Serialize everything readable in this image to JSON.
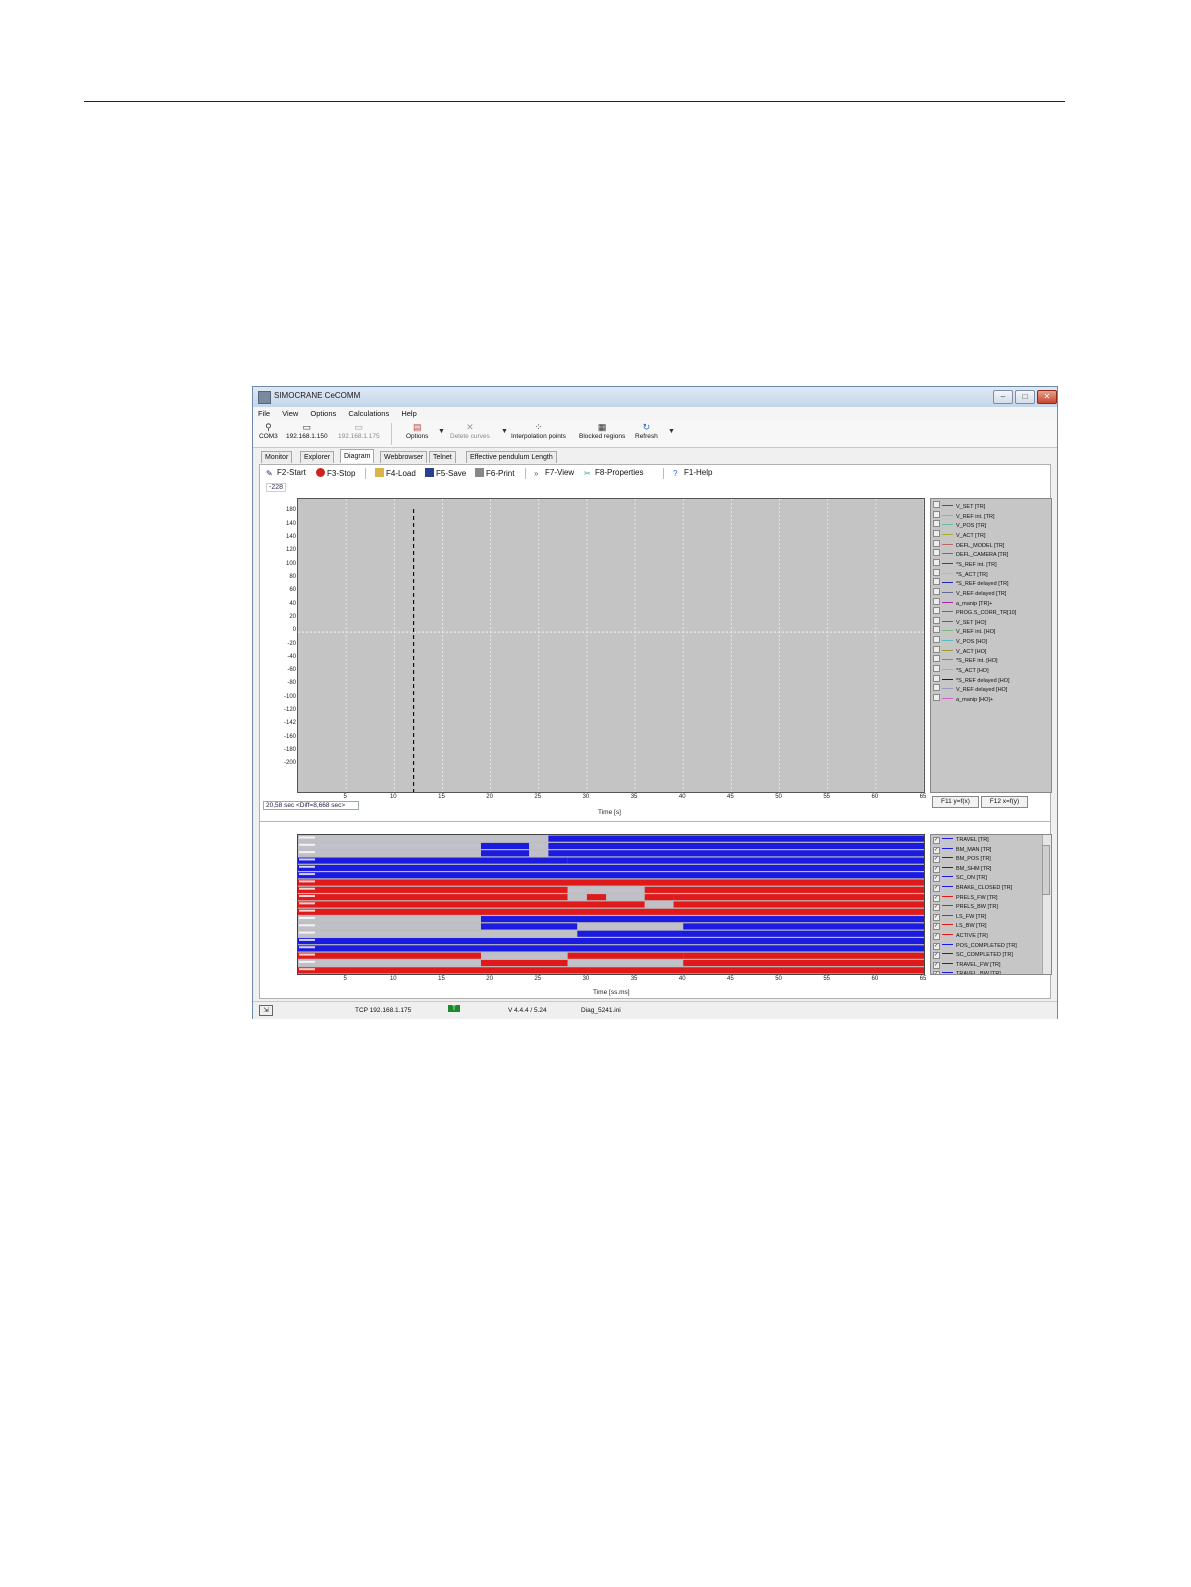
{
  "window": {
    "title": "SIMOCRANE CeCOMM",
    "controls": {
      "minimize": "–",
      "maximize": "□",
      "close": "✕"
    }
  },
  "menu": [
    "File",
    "View",
    "Options",
    "Calculations",
    "Help"
  ],
  "toolbar": {
    "com": "COM3",
    "ip_active": "192.168.1.150",
    "ip_inactive": "192.168.1.175",
    "options": "Options",
    "delete_curves": "Delete curves",
    "interpolation_points": "Interpolation points",
    "blocked_regions": "Blocked regions",
    "refresh": "Refresh"
  },
  "tabs": [
    "Monitor",
    "Explorer",
    "Diagram",
    "Webbrowser",
    "Telnet",
    "Effective pendulum Length"
  ],
  "commands": {
    "start": "F2-Start",
    "stop": "F3-Stop",
    "load": "F4-Load",
    "save": "F5-Save",
    "print": "F6-Print",
    "view": "F7-View",
    "properties": "F8-Properties",
    "help": "F1-Help"
  },
  "readouts": {
    "top_value": "-228",
    "cursor": "20,58 sec <Diff=8,668 sec>"
  },
  "chart_data": [
    {
      "type": "line",
      "title": "",
      "xlabel": "Time [s]",
      "ylabel": "",
      "xlim": [
        0,
        65
      ],
      "ylim": [
        -240,
        200
      ],
      "x_ticks": [
        5,
        10,
        15,
        20,
        25,
        30,
        35,
        40,
        45,
        50,
        55,
        60,
        65
      ],
      "x_tick_labels": [
        "5",
        "10",
        "15",
        "20",
        "25",
        "30",
        "35",
        "40",
        "45",
        "50",
        "55",
        "60",
        "65"
      ],
      "y_ticks": [
        180,
        160,
        140,
        120,
        100,
        80,
        60,
        40,
        20,
        0,
        -20,
        -40,
        -60,
        -80,
        -100,
        -120,
        -140,
        -160,
        -180,
        -200
      ],
      "y_tick_labels": [
        "180",
        "140",
        "140",
        "120",
        "100",
        "80",
        "60",
        "40",
        "20",
        "0",
        "-20",
        "-40",
        "-60",
        "-80",
        "-100",
        "-120",
        "-142",
        "-160",
        "-180",
        "-200"
      ],
      "cursor_x": 12,
      "grid": true,
      "legend_placement": "right",
      "series": [
        {
          "name": "V_SET [TR]",
          "color": "#cc2222",
          "checked": false
        },
        {
          "name": "V_REF int. [TR]",
          "color": "#88bb88",
          "checked": false
        },
        {
          "name": "V_POS [TR]",
          "color": "#66bbaa",
          "checked": false
        },
        {
          "name": "V_ACT [TR]",
          "color": "#aaaa33",
          "checked": false
        },
        {
          "name": "DEFL_MODEL [TR]",
          "color": "#bb6666",
          "checked": false
        },
        {
          "name": "DEFL_CAMERA [TR]",
          "color": "#6666bb",
          "checked": false
        },
        {
          "name": "*S_REF int. [TR]",
          "color": "#444444",
          "checked": false
        },
        {
          "name": "*S_ACT [TR]",
          "color": "#cccc22",
          "checked": false
        },
        {
          "name": "*S_REF delayed [TR]",
          "color": "#2222aa",
          "checked": false
        },
        {
          "name": "V_REF delayed [TR]",
          "color": "#666699",
          "checked": false
        },
        {
          "name": "a_manip [TR]+",
          "color": "#aa22aa",
          "checked": false
        },
        {
          "name": "PROG.S_CORR_TR[10]",
          "color": "#bb33bb",
          "checked": false
        },
        {
          "name": "V_SET [HO]",
          "color": "#cc3333",
          "checked": false
        },
        {
          "name": "V_REF int. [HO]",
          "color": "#77bb77",
          "checked": false
        },
        {
          "name": "V_POS [HO]",
          "color": "#55bbbb",
          "checked": false
        },
        {
          "name": "V_ACT [HO]",
          "color": "#999933",
          "checked": false
        },
        {
          "name": "*S_REF int. [HO]",
          "color": "#888888",
          "checked": false
        },
        {
          "name": "*S_ACT [HO]",
          "color": "#bbbb22",
          "checked": false
        },
        {
          "name": "*S_REF delayed [HO]",
          "color": "#1111aa",
          "checked": false
        },
        {
          "name": "V_REF delayed [HO]",
          "color": "#9999bb",
          "checked": false
        },
        {
          "name": "a_manip [HO]+",
          "color": "#cc66cc",
          "checked": false
        }
      ]
    },
    {
      "type": "heatmap",
      "title": "",
      "xlabel": "Time [ss.ms]",
      "ylabel": "",
      "xlim": [
        0,
        65
      ],
      "x_ticks": [
        5,
        10,
        15,
        20,
        25,
        30,
        35,
        40,
        45,
        50,
        55,
        60,
        65
      ],
      "x_tick_labels": [
        "5",
        "10",
        "15",
        "20",
        "25",
        "30",
        "35",
        "40",
        "45",
        "50",
        "55",
        "60",
        "65"
      ],
      "legend_placement": "right",
      "states_note": "each track: 0 = off (grey), 1 = on (track colour)",
      "tracks": [
        {
          "name": "TRAVEL [TR]",
          "color": "#1a1ae0",
          "checked": true,
          "segments": [
            [
              0,
              26,
              0
            ],
            [
              26,
              65,
              1
            ]
          ]
        },
        {
          "name": "BM_MAN [TR]",
          "color": "#1a1ae0",
          "checked": true,
          "segments": [
            [
              0,
              19,
              0
            ],
            [
              19,
              24,
              1
            ],
            [
              24,
              26,
              0
            ],
            [
              26,
              65,
              1
            ]
          ]
        },
        {
          "name": "BM_POS [TR]",
          "color": "#1a1ae0",
          "checked": true,
          "segments": [
            [
              0,
              19,
              0
            ],
            [
              19,
              24,
              1
            ],
            [
              24,
              26,
              0
            ],
            [
              26,
              65,
              1
            ]
          ]
        },
        {
          "name": "BM_SHM [TR]",
          "color": "#1a1ae0",
          "checked": true,
          "segments": [
            [
              0,
              28,
              1
            ],
            [
              28,
              65,
              1
            ]
          ]
        },
        {
          "name": "SC_ON [TR]",
          "color": "#1a1ae0",
          "checked": true,
          "segments": [
            [
              0,
              65,
              1
            ]
          ]
        },
        {
          "name": "BRAKE_CLOSED [TR]",
          "color": "#1a1ae0",
          "checked": true,
          "segments": [
            [
              0,
              65,
              1
            ]
          ]
        },
        {
          "name": "PRELS_FW [TR]",
          "color": "#e01a1a",
          "checked": true,
          "segments": [
            [
              0,
              65,
              1
            ]
          ]
        },
        {
          "name": "PRELS_BW [TR]",
          "color": "#e01a1a",
          "checked": true,
          "segments": [
            [
              0,
              28,
              1
            ],
            [
              28,
              36,
              0
            ],
            [
              36,
              65,
              1
            ]
          ]
        },
        {
          "name": "LS_FW [TR]",
          "color": "#e01a1a",
          "checked": true,
          "segments": [
            [
              0,
              28,
              1
            ],
            [
              28,
              30,
              0
            ],
            [
              30,
              32,
              1
            ],
            [
              32,
              36,
              0
            ],
            [
              36,
              39,
              1
            ],
            [
              39,
              65,
              1
            ]
          ]
        },
        {
          "name": "LS_BW [TR]",
          "color": "#e01a1a",
          "checked": true,
          "segments": [
            [
              0,
              36,
              1
            ],
            [
              36,
              39,
              0
            ],
            [
              39,
              65,
              1
            ]
          ]
        },
        {
          "name": "ACTIVE [TR]",
          "color": "#e01a1a",
          "checked": true,
          "segments": [
            [
              0,
              65,
              1
            ]
          ]
        },
        {
          "name": "POS_COMPLETED [TR]",
          "color": "#1a1ae0",
          "checked": true,
          "segments": [
            [
              0,
              19,
              0
            ],
            [
              19,
              65,
              1
            ]
          ]
        },
        {
          "name": "SC_COMPLETED [TR]",
          "color": "#1a1ae0",
          "checked": true,
          "segments": [
            [
              0,
              19,
              0
            ],
            [
              19,
              29,
              1
            ],
            [
              29,
              40,
              0
            ],
            [
              40,
              65,
              1
            ]
          ]
        },
        {
          "name": "TRAVEL_FW [TR]",
          "color": "#1a1ae0",
          "checked": true,
          "segments": [
            [
              0,
              29,
              0
            ],
            [
              29,
              65,
              1
            ]
          ]
        },
        {
          "name": "TRAVEL_BW [TR]",
          "color": "#1a1ae0",
          "checked": true,
          "segments": [
            [
              0,
              19,
              1
            ],
            [
              19,
              65,
              1
            ]
          ]
        },
        {
          "name": "",
          "color": "#1a1ae0",
          "checked": false,
          "segments": [
            [
              0,
              65,
              1
            ]
          ]
        },
        {
          "name": "",
          "color": "#e01a1a",
          "checked": false,
          "segments": [
            [
              0,
              19,
              1
            ],
            [
              19,
              28,
              0
            ],
            [
              28,
              40,
              1
            ],
            [
              40,
              65,
              1
            ]
          ]
        },
        {
          "name": "",
          "color": "#e01a1a",
          "checked": false,
          "segments": [
            [
              0,
              19,
              0
            ],
            [
              19,
              28,
              1
            ],
            [
              28,
              40,
              0
            ],
            [
              40,
              65,
              1
            ]
          ]
        },
        {
          "name": "",
          "color": "#e01a1a",
          "checked": false,
          "segments": [
            [
              0,
              65,
              1
            ]
          ]
        }
      ]
    }
  ],
  "function_buttons": {
    "f11": "F11 y=f(x)",
    "f12": "F12 x=f(y)"
  },
  "status": {
    "connection": "TCP 192.168.1.175",
    "indicator": "T",
    "version": "V 4.4.4 / 5.24",
    "file": "Diag_5241.ini"
  },
  "colors": {
    "plot_bg": "#c4c4c4",
    "on_blue": "#1a1ae0",
    "on_red": "#e01a1a",
    "off_grey": "#c0c0c8"
  }
}
